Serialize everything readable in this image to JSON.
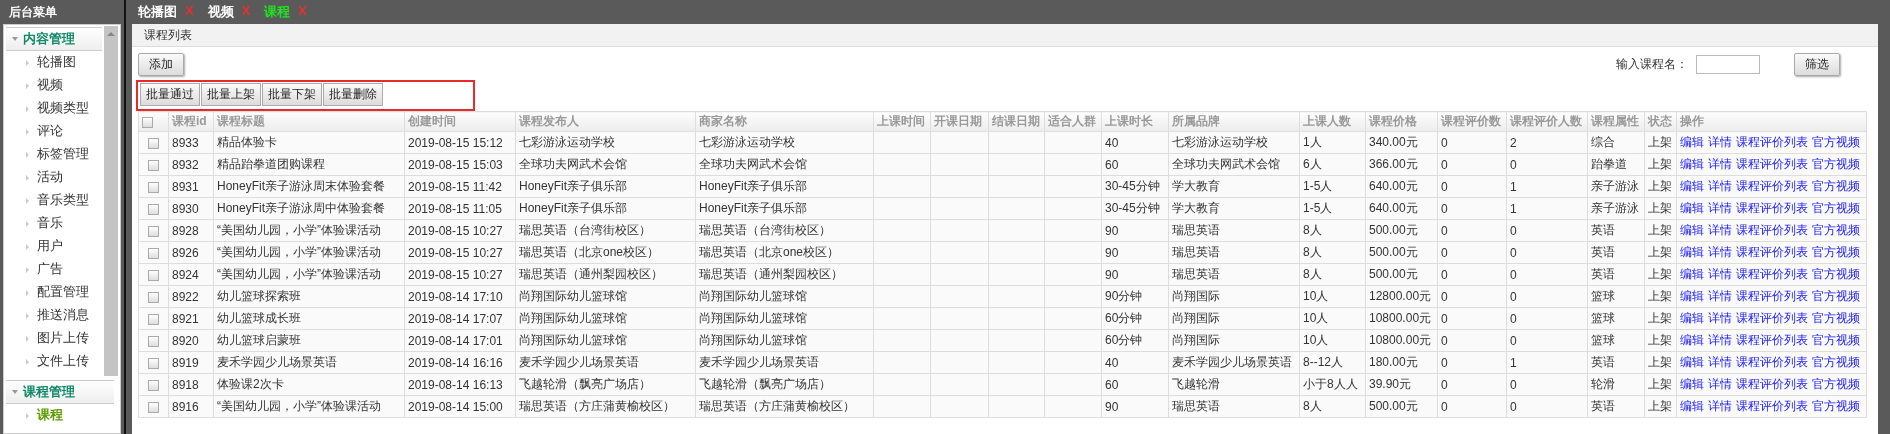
{
  "sidebar": {
    "title": "后台菜单",
    "groups": [
      {
        "label": "内容管理",
        "expanded": true,
        "items": [
          {
            "label": "轮播图",
            "selected": false
          },
          {
            "label": "视频",
            "selected": false
          },
          {
            "label": "视频类型",
            "selected": false
          },
          {
            "label": "评论",
            "selected": false
          },
          {
            "label": "标签管理",
            "selected": false
          },
          {
            "label": "活动",
            "selected": false
          },
          {
            "label": "音乐类型",
            "selected": false
          },
          {
            "label": "音乐",
            "selected": false
          },
          {
            "label": "用户",
            "selected": false
          },
          {
            "label": "广告",
            "selected": false
          },
          {
            "label": "配置管理",
            "selected": false
          },
          {
            "label": "推送消息",
            "selected": false
          },
          {
            "label": "图片上传",
            "selected": false
          },
          {
            "label": "文件上传",
            "selected": false
          }
        ]
      },
      {
        "label": "课程管理",
        "expanded": true,
        "items": [
          {
            "label": "课程",
            "selected": true
          }
        ]
      }
    ]
  },
  "tabs": [
    {
      "label": "轮播图",
      "selected": false,
      "close": "X"
    },
    {
      "label": "视频",
      "selected": false,
      "close": "X"
    },
    {
      "label": "课程",
      "selected": true,
      "close": "X"
    }
  ],
  "panel": {
    "title": "课程列表",
    "add_button": "添加",
    "batch_buttons": [
      "批量通过",
      "批量上架",
      "批量下架",
      "批量删除"
    ],
    "search": {
      "label": "输入课程名："
    },
    "filter_button": "筛选"
  },
  "table": {
    "header_checked": false,
    "columns": [
      "课程id",
      "课程标题",
      "创建时间",
      "课程发布人",
      "商家名称",
      "上课时间",
      "开课日期",
      "结课日期",
      "适合人群",
      "上课时长",
      "所属品牌",
      "上课人数",
      "课程价格",
      "课程评价数",
      "课程评价人数",
      "课程属性",
      "状态",
      "操作"
    ],
    "rows": [
      {
        "checked": false,
        "id": "8933",
        "title": "精品体验卡",
        "created": "2019-08-15 15:12",
        "publisher": "七彩游泳运动学校",
        "merchant": "七彩游泳运动学校",
        "duration": "40",
        "brand": "七彩游泳运动学校",
        "class_size": "1人",
        "price": "340.00元",
        "review_count": "0",
        "reviewer_count": "2",
        "attribute": "综合",
        "status": "上架",
        "actions": [
          "编辑",
          "详情",
          "课程评价列表",
          "官方视频"
        ]
      },
      {
        "checked": false,
        "id": "8932",
        "title": "精品跆拳道团购课程",
        "created": "2019-08-15 15:03",
        "publisher": "全球功夫网武术会馆",
        "merchant": "全球功夫网武术会馆",
        "duration": "60",
        "brand": "全球功夫网武术会馆",
        "class_size": "6人",
        "price": "366.00元",
        "review_count": "0",
        "reviewer_count": "0",
        "attribute": "跆拳道",
        "status": "上架",
        "actions": [
          "编辑",
          "详情",
          "课程评价列表",
          "官方视频"
        ]
      },
      {
        "checked": false,
        "id": "8931",
        "title": "HoneyFit亲子游泳周末体验套餐",
        "created": "2019-08-15 11:42",
        "publisher": "HoneyFit亲子俱乐部",
        "merchant": "HoneyFit亲子俱乐部",
        "duration": "30-45分钟",
        "brand": "学大教育",
        "class_size": "1-5人",
        "price": "640.00元",
        "review_count": "0",
        "reviewer_count": "1",
        "attribute": "亲子游泳",
        "status": "上架",
        "actions": [
          "编辑",
          "详情",
          "课程评价列表",
          "官方视频"
        ]
      },
      {
        "checked": false,
        "id": "8930",
        "title": "HoneyFit亲子游泳周中体验套餐",
        "created": "2019-08-15 11:05",
        "publisher": "HoneyFit亲子俱乐部",
        "merchant": "HoneyFit亲子俱乐部",
        "duration": "30-45分钟",
        "brand": "学大教育",
        "class_size": "1-5人",
        "price": "640.00元",
        "review_count": "0",
        "reviewer_count": "1",
        "attribute": "亲子游泳",
        "status": "上架",
        "actions": [
          "编辑",
          "详情",
          "课程评价列表",
          "官方视频"
        ]
      },
      {
        "checked": false,
        "id": "8928",
        "title": "“美国幼儿园，小学”体验课活动",
        "created": "2019-08-15 10:27",
        "publisher": "瑞思英语（台湾街校区）",
        "merchant": "瑞思英语（台湾街校区）",
        "duration": "90",
        "brand": "瑞思英语",
        "class_size": "8人",
        "price": "500.00元",
        "review_count": "0",
        "reviewer_count": "0",
        "attribute": "英语",
        "status": "上架",
        "actions": [
          "编辑",
          "详情",
          "课程评价列表",
          "官方视频"
        ]
      },
      {
        "checked": false,
        "id": "8926",
        "title": "“美国幼儿园，小学”体验课活动",
        "created": "2019-08-15 10:27",
        "publisher": "瑞思英语（北京one校区）",
        "merchant": "瑞思英语（北京one校区）",
        "duration": "90",
        "brand": "瑞思英语",
        "class_size": "8人",
        "price": "500.00元",
        "review_count": "0",
        "reviewer_count": "0",
        "attribute": "英语",
        "status": "上架",
        "actions": [
          "编辑",
          "详情",
          "课程评价列表",
          "官方视频"
        ]
      },
      {
        "checked": false,
        "id": "8924",
        "title": "“美国幼儿园，小学”体验课活动",
        "created": "2019-08-15 10:27",
        "publisher": "瑞思英语（通州梨园校区）",
        "merchant": "瑞思英语（通州梨园校区）",
        "duration": "90",
        "brand": "瑞思英语",
        "class_size": "8人",
        "price": "500.00元",
        "review_count": "0",
        "reviewer_count": "0",
        "attribute": "英语",
        "status": "上架",
        "actions": [
          "编辑",
          "详情",
          "课程评价列表",
          "官方视频"
        ]
      },
      {
        "checked": false,
        "id": "8922",
        "title": "幼儿篮球探索班",
        "created": "2019-08-14 17:10",
        "publisher": "尚翔国际幼儿篮球馆",
        "merchant": "尚翔国际幼儿篮球馆",
        "duration": "90分钟",
        "brand": "尚翔国际",
        "class_size": "10人",
        "price": "12800.00元",
        "review_count": "0",
        "reviewer_count": "0",
        "attribute": "篮球",
        "status": "上架",
        "actions": [
          "编辑",
          "详情",
          "课程评价列表",
          "官方视频"
        ]
      },
      {
        "checked": false,
        "id": "8921",
        "title": "幼儿篮球成长班",
        "created": "2019-08-14 17:07",
        "publisher": "尚翔国际幼儿篮球馆",
        "merchant": "尚翔国际幼儿篮球馆",
        "duration": "60分钟",
        "brand": "尚翔国际",
        "class_size": "10人",
        "price": "10800.00元",
        "review_count": "0",
        "reviewer_count": "0",
        "attribute": "篮球",
        "status": "上架",
        "actions": [
          "编辑",
          "详情",
          "课程评价列表",
          "官方视频"
        ]
      },
      {
        "checked": false,
        "id": "8920",
        "title": "幼儿篮球启蒙班",
        "created": "2019-08-14 17:01",
        "publisher": "尚翔国际幼儿篮球馆",
        "merchant": "尚翔国际幼儿篮球馆",
        "duration": "60分钟",
        "brand": "尚翔国际",
        "class_size": "10人",
        "price": "10800.00元",
        "review_count": "0",
        "reviewer_count": "0",
        "attribute": "篮球",
        "status": "上架",
        "actions": [
          "编辑",
          "详情",
          "课程评价列表",
          "官方视频"
        ]
      },
      {
        "checked": false,
        "id": "8919",
        "title": "麦禾学园少儿场景英语",
        "created": "2019-08-14 16:16",
        "publisher": "麦禾学园少儿场景英语",
        "merchant": "麦禾学园少儿场景英语",
        "duration": "40",
        "brand": "麦禾学园少儿场景英语",
        "class_size": "8--12人",
        "price": "180.00元",
        "review_count": "0",
        "reviewer_count": "1",
        "attribute": "英语",
        "status": "上架",
        "actions": [
          "编辑",
          "详情",
          "课程评价列表",
          "官方视频"
        ]
      },
      {
        "checked": false,
        "id": "8918",
        "title": "体验课2次卡",
        "created": "2019-08-14 16:13",
        "publisher": "飞越轮滑（飘亮广场店）",
        "merchant": "飞越轮滑（飘亮广场店）",
        "duration": "60",
        "brand": "飞越轮滑",
        "class_size": "小于8人人",
        "price": "39.90元",
        "review_count": "0",
        "reviewer_count": "0",
        "attribute": "轮滑",
        "status": "上架",
        "actions": [
          "编辑",
          "详情",
          "课程评价列表",
          "官方视频"
        ]
      },
      {
        "checked": false,
        "id": "8916",
        "title": "“美国幼儿园，小学”体验课活动",
        "created": "2019-08-14 15:00",
        "publisher": "瑞思英语（方庄蒲黄榆校区）",
        "merchant": "瑞思英语（方庄蒲黄榆校区）",
        "duration": "90",
        "brand": "瑞思英语",
        "class_size": "8人",
        "price": "500.00元",
        "review_count": "0",
        "reviewer_count": "0",
        "attribute": "英语",
        "status": "上架",
        "actions": [
          "编辑",
          "详情",
          "课程评价列表",
          "官方视频"
        ]
      }
    ]
  }
}
